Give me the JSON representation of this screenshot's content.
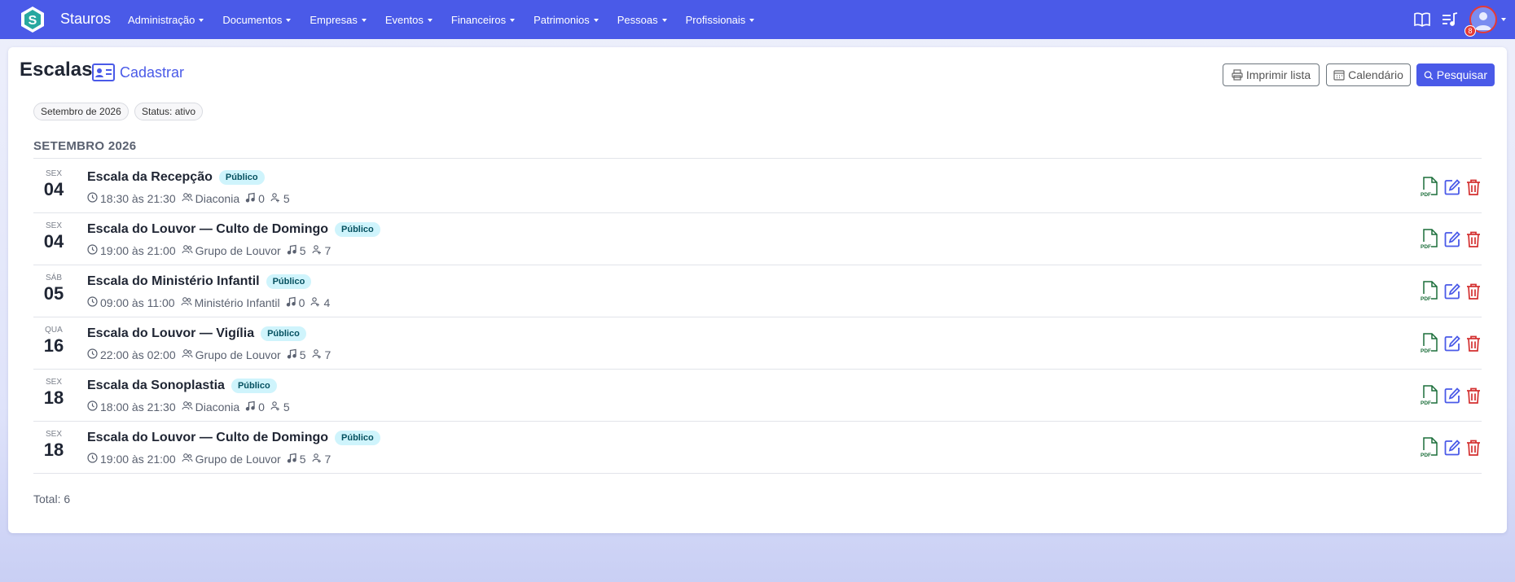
{
  "app": {
    "brand": "Stauros",
    "logo_letter": "S",
    "accent": "#4a5ae8",
    "danger": "#d32f2f",
    "success": "#1b6e3a",
    "notification_count": "8"
  },
  "menu": [
    {
      "label": "Administração"
    },
    {
      "label": "Documentos"
    },
    {
      "label": "Empresas"
    },
    {
      "label": "Eventos"
    },
    {
      "label": "Financeiros"
    },
    {
      "label": "Patrimonios"
    },
    {
      "label": "Pessoas"
    },
    {
      "label": "Profissionais"
    }
  ],
  "nav_icons": [
    "book-icon",
    "playlist-music-icon",
    "user-avatar"
  ],
  "page": {
    "title": "Escalas",
    "create_label": "Cadastrar",
    "print_label": "Imprimir lista",
    "calendar_label": "Calendário",
    "search_label": "Pesquisar"
  },
  "filters": [
    {
      "label": "Setembro de 2026"
    },
    {
      "label": "Status: ativo"
    }
  ],
  "month_header": "SETEMBRO 2026",
  "schedules": [
    {
      "weekday": "SEX",
      "day": "04",
      "title": "Escala da Recepção",
      "badge": "Público",
      "time": "18:30 às 21:30",
      "group": "Diaconia",
      "songs": "0",
      "people": "5"
    },
    {
      "weekday": "SEX",
      "day": "04",
      "title": "Escala do Louvor — Culto de Domingo",
      "badge": "Público",
      "time": "19:00 às 21:00",
      "group": "Grupo de Louvor",
      "songs": "5",
      "people": "7"
    },
    {
      "weekday": "SÁB",
      "day": "05",
      "title": "Escala do Ministério Infantil",
      "badge": "Público",
      "time": "09:00 às 11:00",
      "group": "Ministério Infantil",
      "songs": "0",
      "people": "4"
    },
    {
      "weekday": "QUA",
      "day": "16",
      "title": "Escala do Louvor — Vigília",
      "badge": "Público",
      "time": "22:00 às 02:00",
      "group": "Grupo de Louvor",
      "songs": "5",
      "people": "7"
    },
    {
      "weekday": "SEX",
      "day": "18",
      "title": "Escala da Sonoplastia",
      "badge": "Público",
      "time": "18:00 às 21:30",
      "group": "Diaconia",
      "songs": "0",
      "people": "5"
    },
    {
      "weekday": "SEX",
      "day": "18",
      "title": "Escala do Louvor — Culto de Domingo",
      "badge": "Público",
      "time": "19:00 às 21:00",
      "group": "Grupo de Louvor",
      "songs": "5",
      "people": "7"
    }
  ],
  "row_actions": {
    "pdf_label": "PDF",
    "icons": [
      "pdf-file-icon",
      "edit-icon",
      "trash-icon"
    ]
  },
  "total_label": "Total: 6"
}
